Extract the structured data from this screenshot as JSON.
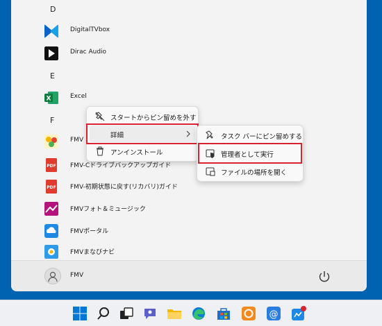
{
  "start_menu": {
    "sections": [
      {
        "letter": "D",
        "apps": [
          {
            "label": "DigitalTVbox",
            "icon": "digitaltvbox-icon"
          },
          {
            "label": "Dirac Audio",
            "icon": "dirac-audio-icon"
          }
        ]
      },
      {
        "letter": "E",
        "apps": [
          {
            "label": "Excel",
            "icon": "excel-icon"
          }
        ]
      },
      {
        "letter": "F",
        "apps": [
          {
            "label": "FMV",
            "icon": "fmv-icon"
          },
          {
            "label": "FMV-Cドライブバックアップガイド",
            "icon": "pdf-icon"
          },
          {
            "label": "FMV-初期状態に戻す(リカバリ)ガイド",
            "icon": "pdf-icon"
          },
          {
            "label": "FMVフォト＆ミュージック",
            "icon": "fmv-photo-music-icon"
          },
          {
            "label": "FMVポータル",
            "icon": "fmv-portal-icon"
          },
          {
            "label": "FMVまなびナビ",
            "icon": "fmv-manabi-navi-icon"
          }
        ]
      }
    ],
    "user": {
      "name": "FMV"
    }
  },
  "context_menu": {
    "items": [
      {
        "label": "スタートからピン留めを外す",
        "icon": "unpin-icon"
      },
      {
        "label": "詳細",
        "icon": "none",
        "has_submenu": true
      },
      {
        "label": "アンインストール",
        "icon": "trash-icon"
      }
    ]
  },
  "submenu": {
    "items": [
      {
        "label": "タスク バーにピン留めする",
        "icon": "pin-icon"
      },
      {
        "label": "管理者として実行",
        "icon": "admin-shield-icon"
      },
      {
        "label": "ファイルの場所を開く",
        "icon": "folder-open-icon"
      }
    ]
  },
  "taskbar": {
    "items": [
      "windows-start-icon",
      "search-icon",
      "task-view-icon",
      "teams-chat-icon",
      "file-explorer-icon",
      "edge-icon",
      "microsoft-store-icon",
      "app-orange-icon",
      "mail-icon",
      "notification-app-icon"
    ]
  },
  "colors": {
    "desktop": "#0063b1",
    "highlight": "#d9232e",
    "menu": "#f3f3f3"
  }
}
